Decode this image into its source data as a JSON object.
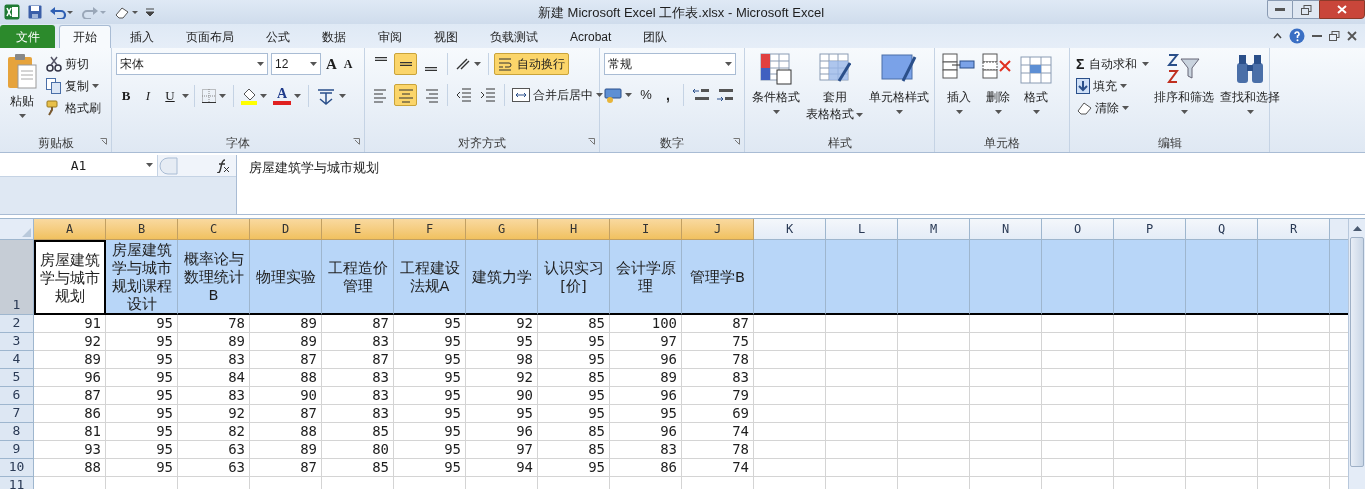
{
  "window": {
    "title": "新建 Microsoft Excel 工作表.xlsx - Microsoft Excel"
  },
  "ribbon_tabs": [
    {
      "label": "文件",
      "kind": "file",
      "selected": false
    },
    {
      "label": "开始",
      "kind": "tab",
      "selected": true
    },
    {
      "label": "插入",
      "kind": "tab",
      "selected": false
    },
    {
      "label": "页面布局",
      "kind": "tab",
      "selected": false
    },
    {
      "label": "公式",
      "kind": "tab",
      "selected": false
    },
    {
      "label": "数据",
      "kind": "tab",
      "selected": false
    },
    {
      "label": "审阅",
      "kind": "tab",
      "selected": false
    },
    {
      "label": "视图",
      "kind": "tab",
      "selected": false
    },
    {
      "label": "负载测试",
      "kind": "tab",
      "selected": false
    },
    {
      "label": "Acrobat",
      "kind": "tab",
      "selected": false
    },
    {
      "label": "团队",
      "kind": "tab",
      "selected": false
    }
  ],
  "ribbon": {
    "clipboard": {
      "label": "剪贴板",
      "paste": "粘贴",
      "cut": "剪切",
      "copy": "复制",
      "format_painter": "格式刷"
    },
    "font": {
      "label": "字体",
      "font_name": "宋体",
      "font_size": "12",
      "grow": "A",
      "shrink": "A",
      "bold": "B",
      "italic": "I",
      "underline": "U",
      "font_color": "A"
    },
    "alignment": {
      "label": "对齐方式",
      "vertical": [
        {
          "selected": false
        },
        {
          "selected": true
        },
        {
          "selected": false
        }
      ],
      "horizontal": [
        {
          "selected": false
        },
        {
          "selected": true
        },
        {
          "selected": false
        }
      ],
      "wrap_text": {
        "label": "自动换行",
        "selected": true
      },
      "merge_center": "合并后居中"
    },
    "number": {
      "label": "数字",
      "format": "常规",
      "percent": "%",
      "comma": ","
    },
    "styles": {
      "label": "样式",
      "conditional": "条件格式",
      "table_format": [
        "套用",
        "表格格式"
      ],
      "cell_styles": "单元格样式"
    },
    "cells": {
      "label": "单元格",
      "insert": "插入",
      "delete": "删除",
      "format": "格式"
    },
    "editing": {
      "label": "编辑",
      "sigma": "Σ",
      "autosum": "自动求和",
      "fill": "填充",
      "clear": "清除",
      "sort_filter": "排序和筛选",
      "find_select": "查找和选择"
    }
  },
  "formula_bar": {
    "name_box": "A1",
    "formula": "房屋建筑学与城市规划"
  },
  "sheet": {
    "columns": [
      {
        "letter": "A",
        "selected": true
      },
      {
        "letter": "B",
        "selected": true
      },
      {
        "letter": "C",
        "selected": true
      },
      {
        "letter": "D",
        "selected": true
      },
      {
        "letter": "E",
        "selected": true
      },
      {
        "letter": "F",
        "selected": true
      },
      {
        "letter": "G",
        "selected": true
      },
      {
        "letter": "H",
        "selected": true
      },
      {
        "letter": "I",
        "selected": true
      },
      {
        "letter": "J",
        "selected": true
      },
      {
        "letter": "K",
        "selected": false
      },
      {
        "letter": "L",
        "selected": false
      },
      {
        "letter": "M",
        "selected": false
      },
      {
        "letter": "N",
        "selected": false
      },
      {
        "letter": "O",
        "selected": false
      },
      {
        "letter": "P",
        "selected": false
      },
      {
        "letter": "Q",
        "selected": false
      },
      {
        "letter": "R",
        "selected": false
      }
    ],
    "rows": [
      {
        "number": "1",
        "kind": "header",
        "selected": true,
        "cells": [
          {
            "text": "房屋建筑学与城市规划",
            "selected": true
          },
          {
            "text": "房屋建筑学与城市规划课程设计",
            "selected": false
          },
          {
            "text": "概率论与数理统计B",
            "selected": false
          },
          {
            "text": "物理实验",
            "selected": false
          },
          {
            "text": "工程造价管理",
            "selected": false
          },
          {
            "text": "工程建设法规A",
            "selected": false
          },
          {
            "text": "建筑力学",
            "selected": false
          },
          {
            "text": "认识实习[价]",
            "selected": false
          },
          {
            "text": "会计学原理",
            "selected": false
          },
          {
            "text": "管理学B",
            "selected": false
          }
        ]
      },
      {
        "number": "2",
        "kind": "data",
        "selected": false,
        "cells": [
          "91",
          "95",
          "78",
          "89",
          "87",
          "95",
          "92",
          "85",
          "100",
          "87"
        ]
      },
      {
        "number": "3",
        "kind": "data",
        "selected": false,
        "cells": [
          "92",
          "95",
          "89",
          "89",
          "83",
          "95",
          "95",
          "95",
          "97",
          "75"
        ]
      },
      {
        "number": "4",
        "kind": "data",
        "selected": false,
        "cells": [
          "89",
          "95",
          "83",
          "87",
          "87",
          "95",
          "98",
          "95",
          "96",
          "78"
        ]
      },
      {
        "number": "5",
        "kind": "data",
        "selected": false,
        "cells": [
          "96",
          "95",
          "84",
          "88",
          "83",
          "95",
          "92",
          "85",
          "89",
          "83"
        ]
      },
      {
        "number": "6",
        "kind": "data",
        "selected": false,
        "cells": [
          "87",
          "95",
          "83",
          "90",
          "83",
          "95",
          "90",
          "95",
          "96",
          "79"
        ]
      },
      {
        "number": "7",
        "kind": "data",
        "selected": false,
        "cells": [
          "86",
          "95",
          "92",
          "87",
          "83",
          "95",
          "95",
          "95",
          "95",
          "69"
        ]
      },
      {
        "number": "8",
        "kind": "data",
        "selected": false,
        "cells": [
          "81",
          "95",
          "82",
          "88",
          "85",
          "95",
          "96",
          "85",
          "96",
          "74"
        ]
      },
      {
        "number": "9",
        "kind": "data",
        "selected": false,
        "cells": [
          "93",
          "95",
          "63",
          "89",
          "80",
          "95",
          "97",
          "85",
          "83",
          "78"
        ]
      },
      {
        "number": "10",
        "kind": "data",
        "selected": false,
        "cells": [
          "88",
          "95",
          "63",
          "87",
          "85",
          "95",
          "94",
          "95",
          "86",
          "74"
        ]
      },
      {
        "number": "11",
        "kind": "data",
        "selected": false
      }
    ]
  }
}
